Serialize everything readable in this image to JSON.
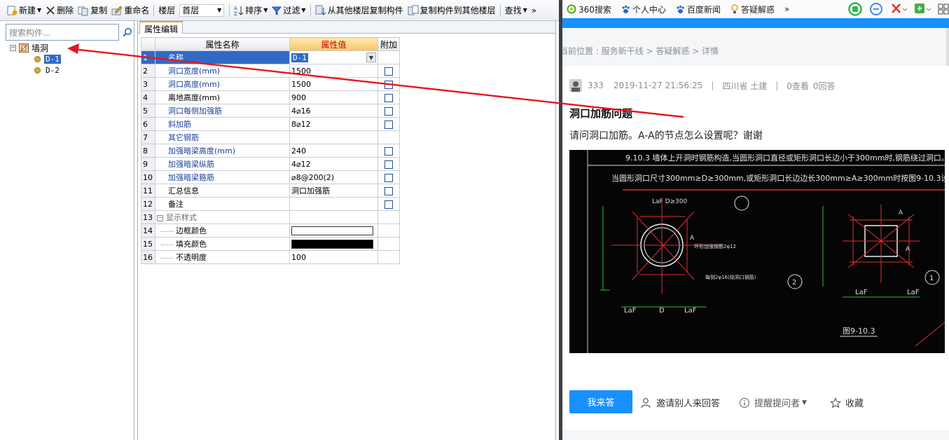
{
  "toolbar": {
    "new_label": "新建",
    "delete_label": "删除",
    "copy_label": "复制",
    "rename_label": "重命名",
    "floor_label": "楼层",
    "floor_value": "首层",
    "sort_label": "排序",
    "filter_label": "过滤",
    "copy_from_label": "从其他楼层复制构件",
    "copy_to_label": "复制构件到其他楼层",
    "find_label": "查找",
    "more_label": "»"
  },
  "tree": {
    "search_placeholder": "搜索构件...",
    "root_label": "墙洞",
    "children": [
      "D-1",
      "D-2"
    ]
  },
  "props": {
    "tab_label": "属性编辑",
    "headers": {
      "name": "属性名称",
      "value": "属性值",
      "extra": "附加"
    },
    "rows": [
      {
        "num": "1",
        "name": "名称",
        "value": "D-1"
      },
      {
        "num": "2",
        "name": "洞口宽度(mm)",
        "value": "1500"
      },
      {
        "num": "3",
        "name": "洞口高度(mm)",
        "value": "1500"
      },
      {
        "num": "4",
        "name": "离地高度(mm)",
        "value": "900"
      },
      {
        "num": "5",
        "name": "洞口每侧加强筋",
        "value": "4⌀16"
      },
      {
        "num": "6",
        "name": "斜加筋",
        "value": "8⌀12"
      },
      {
        "num": "7",
        "name": "其它钢筋",
        "value": ""
      },
      {
        "num": "8",
        "name": "加强暗梁高度(mm)",
        "value": "240"
      },
      {
        "num": "9",
        "name": "加强暗梁纵筋",
        "value": "4⌀12"
      },
      {
        "num": "10",
        "name": "加强暗梁箍筋",
        "value": "⌀8@200(2)"
      },
      {
        "num": "11",
        "name": "汇总信息",
        "value": "洞口加强筋"
      },
      {
        "num": "12",
        "name": "备注",
        "value": ""
      },
      {
        "num": "13",
        "name": "显示样式",
        "value": ""
      },
      {
        "num": "14",
        "name": "边框颜色",
        "value": ""
      },
      {
        "num": "15",
        "name": "填充颜色",
        "value": ""
      },
      {
        "num": "16",
        "name": "不透明度",
        "value": "100"
      }
    ],
    "border_color": "#ffffff",
    "fill_color": "#000000"
  },
  "browser": {
    "bookmarks": [
      "360搜索",
      "个人中心",
      "百度新闻",
      "答疑解惑",
      "»"
    ],
    "breadcrumb": "当前位置 : 服务新干线 > 答疑解惑 > 详情",
    "user": "333",
    "datetime": "2019-11-27 21:56:25",
    "location": "四川省 土建",
    "views": "0查看",
    "answers": "0回答",
    "question_title": "洞口加筋问题",
    "question_body": "请问洞口加筋。A-A的节点怎么设置呢？谢谢",
    "answer_button": "我来答",
    "invite_label": "邀请别人来回答",
    "remind_label": "提醒提问者",
    "collect_label": "收藏",
    "accent_color": "#1890ff"
  },
  "cad": {
    "line1": "9.10.3 墙体上开洞时钢筋构造,当圆形洞口直径或矩形洞口长边小于300mm时,钢筋绕过洞口。",
    "line2": "当圆形洞口尺寸300mm≥D≥300mm,或矩形洞口长边边长300mm≥A≥300mm时按图9-10.3设置。",
    "label_laf1": "LaF D≥300",
    "label_a": "A",
    "label_d": "D",
    "label_laf": "LaF",
    "label_n1": "1",
    "label_n2": "2",
    "label_fig": "图9-10.3",
    "label_note1": "环形加强钢筋2φ12",
    "label_note2": "每侧2φ16(绕洞口钢筋)"
  }
}
